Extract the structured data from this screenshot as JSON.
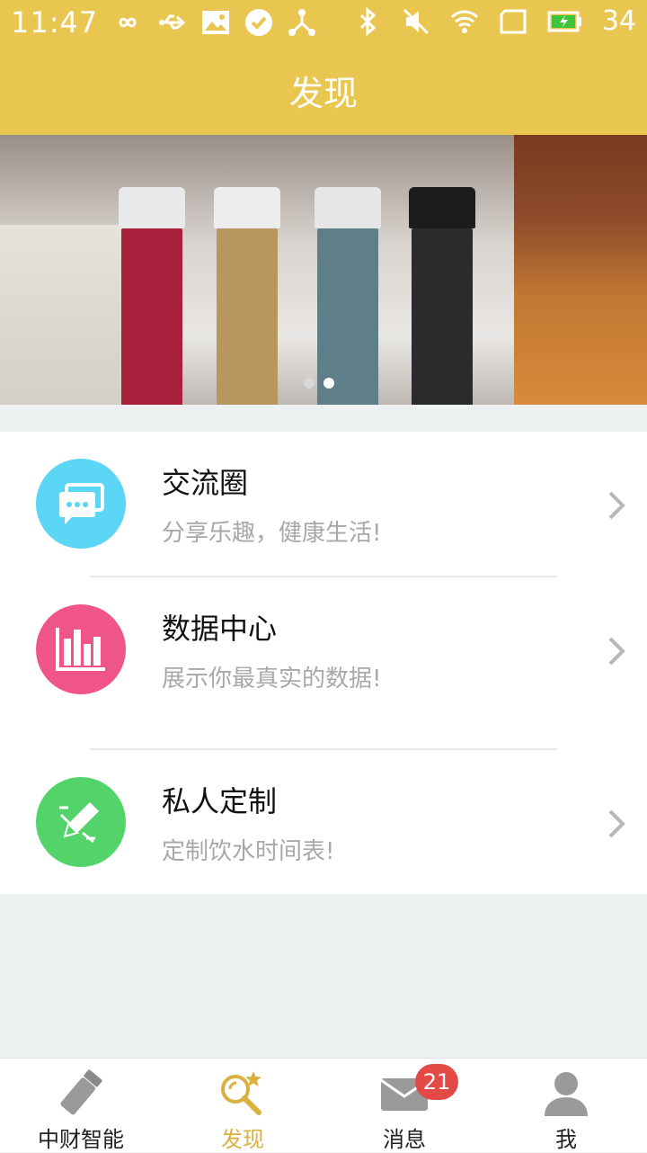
{
  "status_bar": {
    "time": "11:47",
    "battery_level": "34",
    "icons_left": [
      "infinity-icon",
      "usb-icon",
      "image-icon",
      "check-circle-icon",
      "share-network-icon"
    ],
    "icons_right": [
      "bluetooth-icon",
      "mute-icon",
      "wifi-icon",
      "sim-icon",
      "battery-charging-icon"
    ]
  },
  "header": {
    "title": "发现"
  },
  "banner": {
    "slides": 2,
    "active_slide": 2,
    "bottles": [
      {
        "cap": "#e9e8ea",
        "body": "#a8203c"
      },
      {
        "cap": "#ecebed",
        "body": "#b8975f"
      },
      {
        "cap": "#e6e6e8",
        "body": "#5e7f8a"
      },
      {
        "cap": "#1c1c1c",
        "body": "#2b2b2d"
      }
    ]
  },
  "list": {
    "items": [
      {
        "title": "交流圈",
        "subtitle": "分享乐趣，健康生活!",
        "icon": "chat-bubbles-icon",
        "color": "#5bd6f5"
      },
      {
        "title": "数据中心",
        "subtitle": "展示你最真实的数据!",
        "icon": "bar-chart-icon",
        "color": "#f0558a"
      },
      {
        "title": "私人定制",
        "subtitle": "定制饮水时间表!",
        "icon": "edit-pencil-icon",
        "color": "#53d46b"
      }
    ]
  },
  "tabbar": {
    "tabs": [
      {
        "label": "中财智能",
        "icon": "bottle-icon",
        "active": false
      },
      {
        "label": "发现",
        "icon": "magnifier-star-icon",
        "active": true
      },
      {
        "label": "消息",
        "icon": "envelope-icon",
        "active": false,
        "badge": "21"
      },
      {
        "label": "我",
        "icon": "user-icon",
        "active": false
      }
    ]
  },
  "colors": {
    "accent": "#e8c650",
    "active_tab": "#d9b13f",
    "badge": "#e34a45"
  }
}
